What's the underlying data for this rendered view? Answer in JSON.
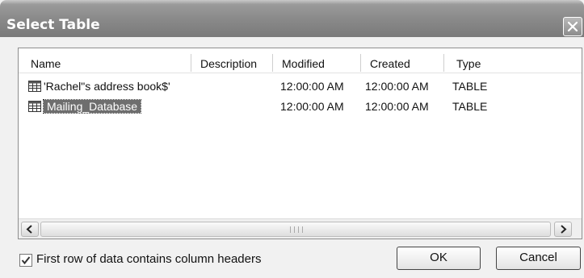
{
  "dialog": {
    "title": "Select Table"
  },
  "table": {
    "columns": [
      "Name",
      "Description",
      "Modified",
      "Created",
      "Type"
    ],
    "rows": [
      {
        "name": "'Rachel\"s address book$'",
        "description": "",
        "modified": "12:00:00 AM",
        "created": "12:00:00 AM",
        "type": "TABLE",
        "selected": false
      },
      {
        "name": "Mailing_Database",
        "description": "",
        "modified": "12:00:00 AM",
        "created": "12:00:00 AM",
        "type": "TABLE",
        "selected": true
      }
    ]
  },
  "options": {
    "first_row_headers_label": "First row of data contains column headers",
    "first_row_headers_checked": true
  },
  "buttons": {
    "ok": "OK",
    "cancel": "Cancel"
  },
  "icons": {
    "close": "close-icon",
    "table": "table-icon",
    "scroll_left": "chevron-left-icon",
    "scroll_right": "chevron-right-icon",
    "check": "checkmark-icon"
  }
}
